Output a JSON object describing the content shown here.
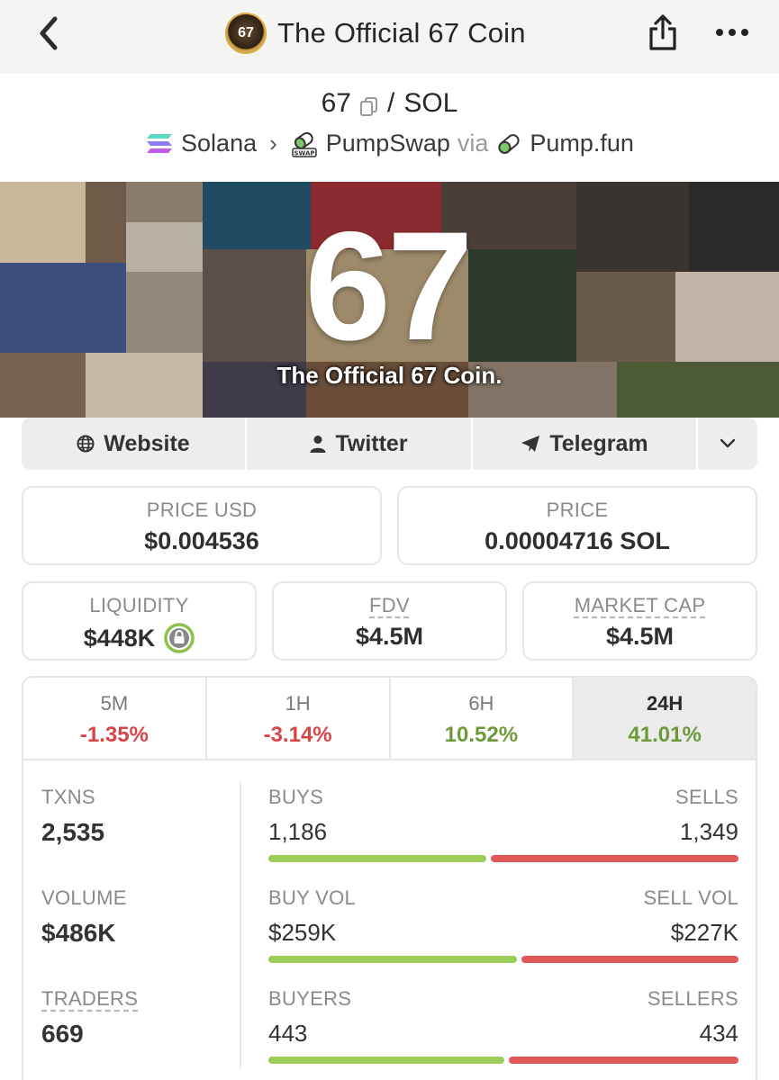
{
  "header": {
    "title": "The Official 67 Coin",
    "logo_text": "67",
    "back_icon": "chevron-left-icon",
    "share_icon": "share-icon",
    "more_icon": "more-horizontal-icon"
  },
  "pair": {
    "base": "67",
    "separator": "/",
    "quote": "SOL",
    "chain": "Solana",
    "dex": "PumpSwap",
    "via": "via",
    "launchpad": "Pump.fun"
  },
  "banner": {
    "big_text": "67",
    "caption": "The Official 67 Coin."
  },
  "links": {
    "website": "Website",
    "twitter": "Twitter",
    "telegram": "Telegram"
  },
  "stats": {
    "price_usd_label": "PRICE USD",
    "price_usd": "$0.004536",
    "price_label": "PRICE",
    "price": "0.00004716 SOL",
    "liquidity_label": "LIQUIDITY",
    "liquidity": "$448K",
    "fdv_label": "FDV",
    "fdv": "$4.5M",
    "mcap_label": "MARKET CAP",
    "mcap": "$4.5M"
  },
  "tabs": [
    {
      "label": "5M",
      "value": "-1.35%"
    },
    {
      "label": "1H",
      "value": "-3.14%"
    },
    {
      "label": "6H",
      "value": "10.52%"
    },
    {
      "label": "24H",
      "value": "41.01%"
    }
  ],
  "metrics": {
    "txns_label": "TXNS",
    "txns": "2,535",
    "volume_label": "VOLUME",
    "volume": "$486K",
    "traders_label": "TRADERS",
    "traders": "669"
  },
  "splits": {
    "buys_label": "BUYS",
    "buys": "1,186",
    "sells_label": "SELLS",
    "sells": "1,349",
    "buys_fraction": 0.468,
    "buyvol_label": "BUY VOL",
    "buyvol": "$259K",
    "sellvol_label": "SELL VOL",
    "sellvol": "$227K",
    "buyvol_fraction": 0.533,
    "buyers_label": "BUYERS",
    "buyers": "443",
    "sellers_label": "SELLERS",
    "sellers": "434",
    "buyers_fraction": 0.505
  },
  "colors": {
    "positive": "#6f9a3a",
    "negative": "#d64545",
    "buy_bar": "#9ccc5a",
    "sell_bar": "#e05858"
  }
}
